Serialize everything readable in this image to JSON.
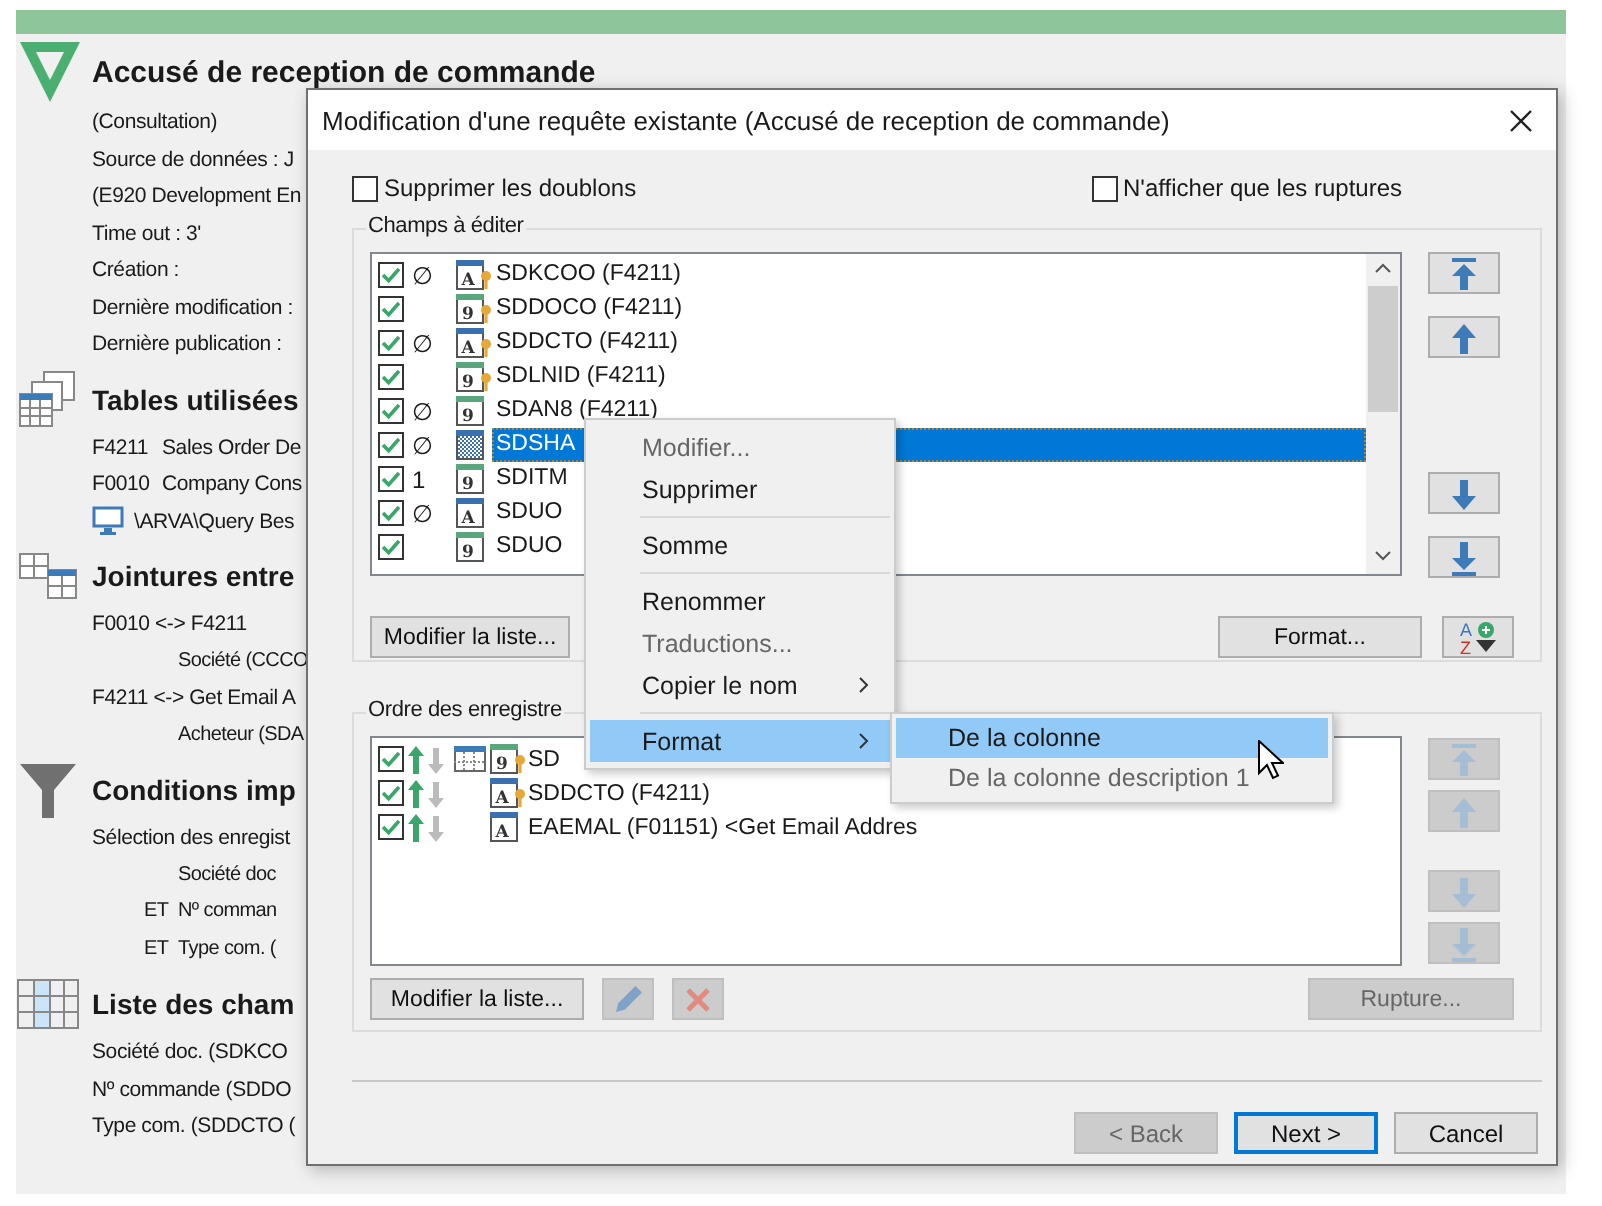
{
  "report": {
    "title": "Accusé de reception de commande",
    "details": [
      "(Consultation)",
      "Source de données : J",
      "(E920 Development En",
      "Time out : 3'",
      "Création :",
      "Dernière modification :",
      "Dernière publication :"
    ],
    "sections": [
      {
        "kind": "tables",
        "title": "Tables utilisées",
        "lines": [
          {
            "kind": "table",
            "code": "F4211",
            "text": "Sales Order De"
          },
          {
            "kind": "table",
            "code": "F0010",
            "text": "Company Cons"
          },
          {
            "kind": "query",
            "text": "\\ARVA\\Query Bes"
          }
        ]
      },
      {
        "kind": "joins",
        "title": "Jointures entre",
        "lines": [
          {
            "kind": "plain",
            "text": "F0010 <-> F4211",
            "children": [
              {
                "text": "Société (CCCO"
              }
            ]
          },
          {
            "kind": "plain",
            "text": "F4211 <-> Get Email A",
            "children": [
              {
                "text": "Acheteur (SDA"
              }
            ]
          }
        ]
      },
      {
        "kind": "conditions",
        "title": "Conditions imp",
        "lines": [
          {
            "kind": "plain",
            "text": "Sélection des enregist",
            "children": [
              {
                "text": "Société doc"
              },
              {
                "prefix": "ET",
                "text": "Nº comman"
              },
              {
                "prefix": "ET",
                "text": "Type com. ("
              }
            ]
          }
        ]
      },
      {
        "kind": "columns",
        "title": "Liste des cham",
        "lines": [
          {
            "kind": "plain",
            "text": "Société doc. (SDKCO"
          },
          {
            "kind": "plain",
            "text": "Nº commande (SDDO"
          },
          {
            "kind": "plain",
            "text": "Type com. (SDDCTO ("
          }
        ]
      }
    ]
  },
  "dialog": {
    "title": "Modification d'une requête existante (Accusé de reception de commande)",
    "options": [
      {
        "label": "Supprimer les doublons",
        "checked": false
      },
      {
        "label": "N'afficher que les ruptures",
        "checked": false
      }
    ],
    "fields": {
      "legend": "Champs à éditer",
      "rows": [
        {
          "checked": true,
          "marker": "∅",
          "kind": "alpha",
          "glyph": "A",
          "key": true,
          "name": "SDKCOO (F4211)",
          "selected": false
        },
        {
          "checked": true,
          "kind": "numeric",
          "glyph": "9",
          "key": true,
          "name": "SDDOCO (F4211)",
          "selected": false
        },
        {
          "checked": true,
          "marker": "∅",
          "kind": "alpha",
          "glyph": "A",
          "key": true,
          "name": "SDDCTO (F4211)",
          "selected": false
        },
        {
          "checked": true,
          "kind": "numeric",
          "glyph": "9",
          "key": true,
          "name": "SDLNID (F4211)",
          "selected": false
        },
        {
          "checked": true,
          "marker": "∅",
          "kind": "numeric",
          "glyph": "9",
          "key": false,
          "name": "SDAN8 (F4211)",
          "selected": false
        },
        {
          "checked": true,
          "marker": "∅",
          "kind": "pattern",
          "key": false,
          "name": "SDSHA",
          "selected": true
        },
        {
          "checked": true,
          "marker": "1",
          "kind": "numeric",
          "glyph": "9",
          "key": false,
          "name": "SDITM",
          "selected": false
        },
        {
          "checked": true,
          "marker": "∅",
          "kind": "alpha",
          "glyph": "A",
          "key": false,
          "name": "SDUO",
          "selected": false
        },
        {
          "checked": true,
          "kind": "numeric",
          "glyph": "9",
          "key": false,
          "name": "SDUO",
          "selected": false
        }
      ],
      "move_buttons": [
        {
          "kind": "top",
          "disabled": false
        },
        {
          "kind": "up",
          "disabled": false
        },
        {
          "kind": "down",
          "disabled": false
        },
        {
          "kind": "bottom",
          "disabled": false
        }
      ],
      "edit_button": "Modifier la liste...",
      "format_button": "Format...",
      "sort_glyphs": [
        "A",
        "Z"
      ]
    },
    "order": {
      "legend": "Ordre des enregistre",
      "rows": [
        {
          "checked": true,
          "ascending": true,
          "table_icon": true,
          "kind": "numeric",
          "glyph": "9",
          "key": true,
          "name": "SD"
        },
        {
          "checked": true,
          "ascending": true,
          "table_icon": false,
          "kind": "alpha",
          "glyph": "A",
          "key": true,
          "name": "SDDCTO (F4211)"
        },
        {
          "checked": true,
          "ascending": true,
          "table_icon": false,
          "kind": "alpha",
          "glyph": "A",
          "key": false,
          "name": "EAEMAL (F01151) <Get Email Addres"
        }
      ],
      "move_buttons": [
        {
          "kind": "top",
          "disabled": true
        },
        {
          "kind": "up",
          "disabled": true
        },
        {
          "kind": "down",
          "disabled": true
        },
        {
          "kind": "bottom",
          "disabled": true
        }
      ],
      "edit_button": "Modifier la liste...",
      "edit_disabled": true,
      "delete_disabled": true,
      "break_button": {
        "label": "Rupture...",
        "disabled": true
      }
    },
    "footer": [
      {
        "label": "< Back",
        "disabled": true,
        "default": false
      },
      {
        "label": "Next >",
        "disabled": false,
        "default": true
      },
      {
        "label": "Cancel",
        "disabled": false,
        "default": false
      }
    ]
  },
  "context_menu": {
    "items": [
      {
        "kind": "item",
        "label": "Modifier...",
        "disabled": true,
        "submenu": false,
        "selected": false
      },
      {
        "kind": "item",
        "label": "Supprimer",
        "disabled": false,
        "submenu": false,
        "selected": false
      },
      {
        "kind": "separator"
      },
      {
        "kind": "item",
        "label": "Somme",
        "disabled": false,
        "submenu": false,
        "selected": false
      },
      {
        "kind": "separator"
      },
      {
        "kind": "item",
        "label": "Renommer",
        "disabled": false,
        "submenu": false,
        "selected": false
      },
      {
        "kind": "item",
        "label": "Traductions...",
        "disabled": true,
        "submenu": false,
        "selected": false
      },
      {
        "kind": "item",
        "label": "Copier le nom",
        "disabled": false,
        "submenu": true,
        "selected": false
      },
      {
        "kind": "separator"
      },
      {
        "kind": "item",
        "label": "Format",
        "disabled": false,
        "submenu": true,
        "selected": true
      }
    ],
    "submenu": [
      {
        "label": "De la colonne",
        "disabled": false,
        "selected": true
      },
      {
        "label": "De la colonne description 1",
        "disabled": true,
        "selected": false
      }
    ]
  }
}
